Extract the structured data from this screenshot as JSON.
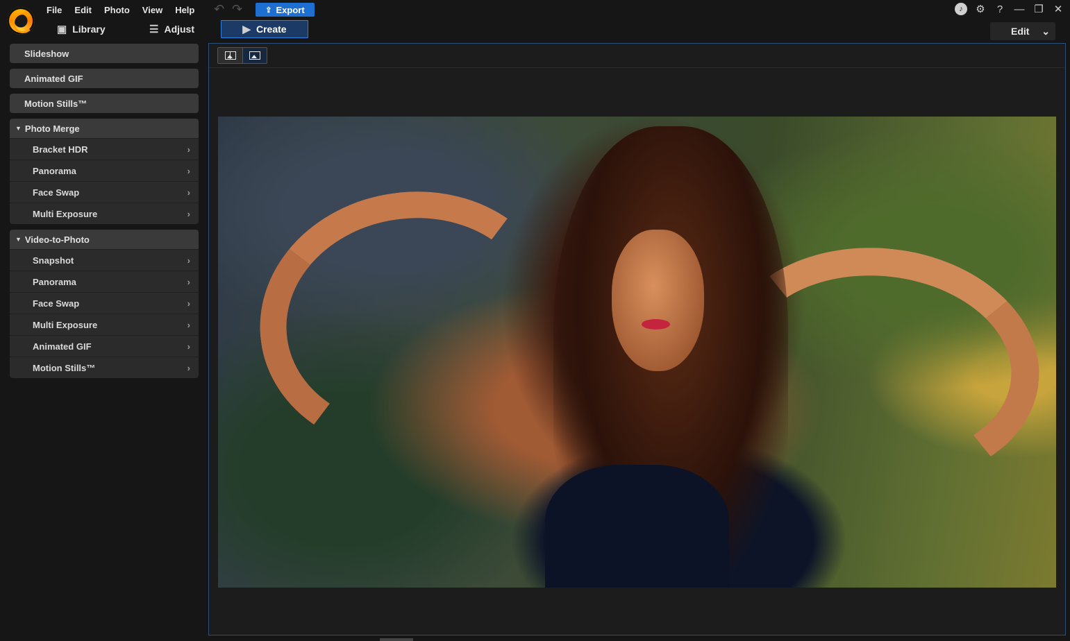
{
  "menu": [
    "File",
    "Edit",
    "Photo",
    "View",
    "Help"
  ],
  "toolbar": {
    "export_label": "Export"
  },
  "modes": {
    "library": "Library",
    "adjust": "Adjust",
    "create": "Create"
  },
  "edit_dropdown": {
    "label": "Edit"
  },
  "sidebar": {
    "slideshow": "Slideshow",
    "animated_gif": "Animated GIF",
    "motion_stills": "Motion Stills™",
    "photo_merge": {
      "title": "Photo Merge",
      "items": [
        "Bracket HDR",
        "Panorama",
        "Face Swap",
        "Multi Exposure"
      ]
    },
    "video_to_photo": {
      "title": "Video-to-Photo",
      "items": [
        "Snapshot",
        "Panorama",
        "Face Swap",
        "Multi Exposure",
        "Animated GIF",
        "Motion Stills™"
      ]
    }
  },
  "icons": {
    "app_logo": "app-logo-icon",
    "undo": "undo-icon",
    "redo": "redo-icon",
    "export": "upload-icon",
    "notification": "bell-icon",
    "settings": "gear-icon",
    "help": "question-icon",
    "minimize": "minimize-icon",
    "restore": "restore-icon",
    "close": "close-icon"
  },
  "colors": {
    "accent": "#1d6fd1",
    "panel": "#3a3a3a",
    "background": "#161616"
  }
}
